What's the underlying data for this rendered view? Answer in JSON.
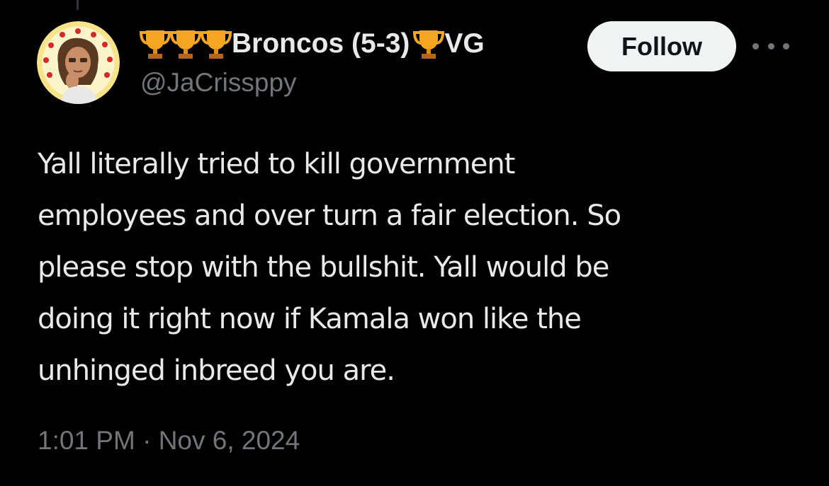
{
  "user": {
    "display_name": "Broncos (5-3)",
    "name_suffix": "VG",
    "handle": "@JaCrissppy",
    "avatar_icon": "bitmoji-avatar",
    "badge_icon": "trophy-emoji"
  },
  "actions": {
    "follow_label": "Follow",
    "more_icon": "more-dots-icon"
  },
  "tweet": {
    "lines": [
      "Yall literally tried to kill government",
      "employees and over turn a fair election. So",
      "please stop with the bullshit. Yall would be",
      "doing it right now if Kamala won like the",
      "unhinged inbreed you are."
    ],
    "time": "1:01 PM",
    "separator": "·",
    "date": "Nov 6, 2024"
  },
  "colors": {
    "background": "#000000",
    "text": "#e7e9ea",
    "secondary": "#71767b",
    "button_bg": "#eff3f4",
    "button_text": "#0f1419"
  }
}
